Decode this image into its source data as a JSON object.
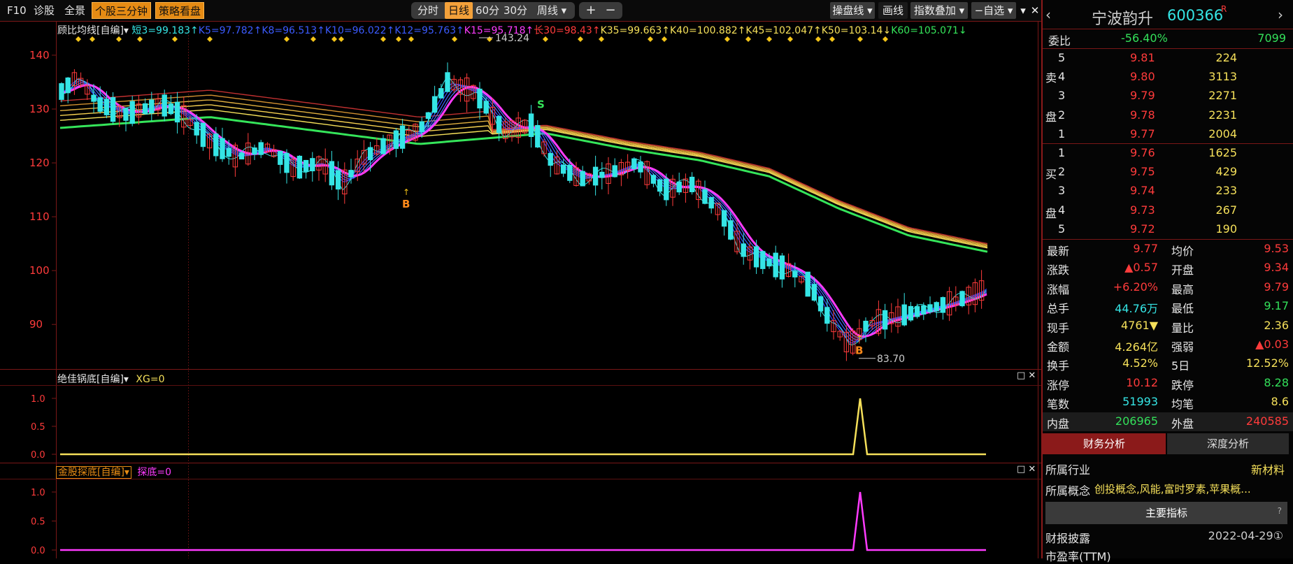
{
  "toolbar": {
    "f10": "F10",
    "diagnose": "诊股",
    "fullscreen": "全景",
    "three_min": "个股三分钟",
    "strategy": "策略看盘",
    "periods": [
      "分时",
      "日线",
      "60分",
      "30分",
      "周线 ▾"
    ],
    "active_period": "日线",
    "zoom_in": "+",
    "zoom_out": "−",
    "drawing_alert": "操盘线 ▾",
    "draw": "画线",
    "index_overlay": "指数叠加 ▾",
    "watchlist": "−自选 ▾",
    "collapse": "▾",
    "close": "✕"
  },
  "main_indicator": {
    "name": "顾比均线[自编]▾",
    "values": [
      {
        "text": "短3=99.183↑",
        "color": "#35e5e5"
      },
      {
        "text": "K5=97.782↑",
        "color": "#3b5bff"
      },
      {
        "text": "K8=96.513↑",
        "color": "#3b5bff"
      },
      {
        "text": "K10=96.022↑",
        "color": "#3b5bff"
      },
      {
        "text": "K12=95.763↑",
        "color": "#3b5bff"
      },
      {
        "text": "K15=95.718↑",
        "color": "#ff3bff"
      },
      {
        "text": "长30=98.43↑",
        "color": "#ff3b3b"
      },
      {
        "text": "K35=99.663↑",
        "color": "#f5e05a"
      },
      {
        "text": "K40=100.882↑",
        "color": "#f5e05a"
      },
      {
        "text": "K45=102.047↑",
        "color": "#f5e05a"
      },
      {
        "text": "K50=103.14↓",
        "color": "#f5e05a"
      },
      {
        "text": "K60=105.071↓",
        "color": "#35e55a"
      }
    ]
  },
  "chart_data": {
    "type": "candlestick",
    "y_axis_ticks": [
      140,
      130,
      120,
      110,
      100,
      90
    ],
    "ylim": [
      82.5,
      143.5
    ],
    "high_label": "143.24",
    "low_label": "83.70",
    "markers": [
      {
        "text": "B",
        "color": "#ff8a1a"
      },
      {
        "text": "S",
        "color": "#35e55a"
      },
      {
        "text": "B",
        "color": "#ff8a1a"
      }
    ]
  },
  "sub1": {
    "name": "绝佳锅底[自编]▾",
    "value": "XG=0",
    "ticks": [
      "1.0",
      "0.5",
      "0.0"
    ]
  },
  "sub2": {
    "name": "金股探底[自编]▾",
    "value": "探底=0",
    "ticks": [
      "1.0",
      "0.5",
      "0.0"
    ]
  },
  "panel": {
    "name": "宁波韵升",
    "code": "600366",
    "tag": "R",
    "weibi_label": "委比",
    "weibi_value": "-56.40%",
    "weibi_diff": "7099",
    "sell_label": [
      "卖",
      "盘"
    ],
    "buy_label": [
      "买",
      "盘"
    ],
    "sell": [
      {
        "n": "5",
        "price": "9.81",
        "vol": "224"
      },
      {
        "n": "4",
        "price": "9.80",
        "vol": "3113"
      },
      {
        "n": "3",
        "price": "9.79",
        "vol": "2271"
      },
      {
        "n": "2",
        "price": "9.78",
        "vol": "2231"
      },
      {
        "n": "1",
        "price": "9.77",
        "vol": "2004"
      }
    ],
    "buy": [
      {
        "n": "1",
        "price": "9.76",
        "vol": "1625"
      },
      {
        "n": "2",
        "price": "9.75",
        "vol": "429"
      },
      {
        "n": "3",
        "price": "9.74",
        "vol": "233"
      },
      {
        "n": "4",
        "price": "9.73",
        "vol": "267"
      },
      {
        "n": "5",
        "price": "9.72",
        "vol": "190"
      }
    ],
    "stats": [
      {
        "l1": "最新",
        "v1": "9.77",
        "c1": "red",
        "l2": "均价",
        "v2": "9.53",
        "c2": "red"
      },
      {
        "l1": "涨跌",
        "v1": "▲0.57",
        "c1": "red",
        "l2": "开盘",
        "v2": "9.34",
        "c2": "red"
      },
      {
        "l1": "涨幅",
        "v1": "+6.20%",
        "c1": "red",
        "l2": "最高",
        "v2": "9.79",
        "c2": "red"
      },
      {
        "l1": "总手",
        "v1": "44.76万",
        "c1": "cyan",
        "l2": "最低",
        "v2": "9.17",
        "c2": "green"
      },
      {
        "l1": "现手",
        "v1": "4761▼",
        "c1": "yellow",
        "l2": "量比",
        "v2": "2.36",
        "c2": "yellow"
      },
      {
        "l1": "金额",
        "v1": "4.264亿",
        "c1": "yellow",
        "l2": "强弱",
        "v2": "▲0.03",
        "c2": "red"
      },
      {
        "l1": "换手",
        "v1": "4.52%",
        "c1": "yellow",
        "l2": "5日",
        "v2": "12.52%",
        "c2": "yellow"
      },
      {
        "l1": "涨停",
        "v1": "10.12",
        "c1": "red",
        "l2": "跌停",
        "v2": "8.28",
        "c2": "green"
      },
      {
        "l1": "笔数",
        "v1": "51993",
        "c1": "cyan",
        "l2": "均笔",
        "v2": "8.6",
        "c2": "yellow"
      },
      {
        "l1": "内盘",
        "v1": "206965",
        "c1": "green",
        "l2": "外盘",
        "v2": "240585",
        "c2": "red"
      }
    ],
    "tab_fin": "财务分析",
    "tab_depth": "深度分析",
    "industry_label": "所属行业",
    "industry_value": "新材料",
    "concept_label": "所属概念",
    "concept_value": "创投概念,风能,富时罗素,苹果概...",
    "main_index": "主要指标",
    "report_label": "财报披露",
    "report_value": "2022-04-29①",
    "pe_label": "市盈率(TTM)"
  }
}
